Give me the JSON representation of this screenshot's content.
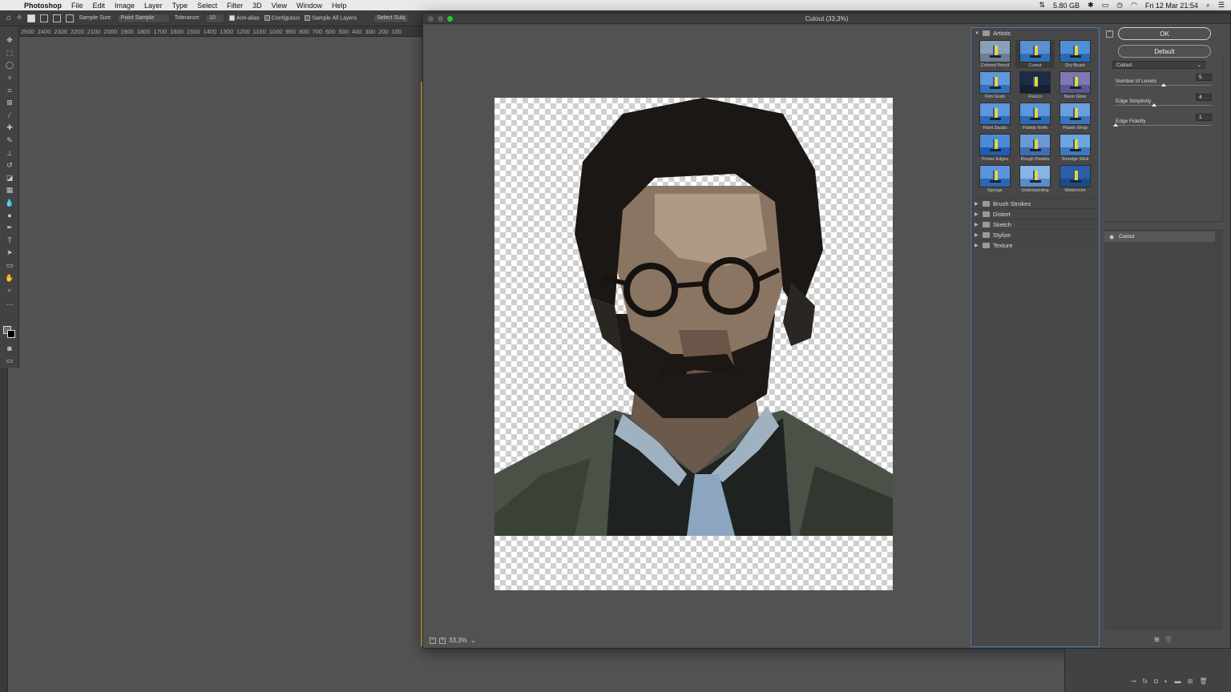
{
  "menubar": {
    "app": "Photoshop",
    "items": [
      "File",
      "Edit",
      "Image",
      "Layer",
      "Type",
      "Select",
      "Filter",
      "3D",
      "View",
      "Window",
      "Help"
    ],
    "memory": "5.80 GB",
    "clock": "Fri 12 Mar  21:54"
  },
  "options_bar": {
    "sample_size_label": "Sample Size:",
    "sample_size_value": "Point Sample",
    "tolerance_label": "Tolerance:",
    "tolerance_value": "10",
    "anti_alias": "Anti-alias",
    "contiguous": "Contiguous",
    "sample_all_layers": "Sample All Layers",
    "select_subject": "Select Subj"
  },
  "ruler": [
    "2500",
    "2400",
    "2300",
    "2200",
    "2100",
    "2000",
    "1900",
    "1800",
    "1700",
    "1600",
    "1500",
    "1400",
    "1300",
    "1200",
    "1100",
    "1000",
    "900",
    "800",
    "700",
    "600",
    "500",
    "400",
    "300",
    "200",
    "100"
  ],
  "dialog": {
    "title": "Cutout (33,3%)",
    "zoom": "33,3%",
    "ok": "OK",
    "default": "Default",
    "selected_filter": "Cutout"
  },
  "gallery": {
    "open_category": "Artistic",
    "filters": [
      {
        "label": "Colored Pencil",
        "sky": "#8aa0b8",
        "sea": "#6a7f96"
      },
      {
        "label": "Cutout",
        "sky": "#5a8fd0",
        "sea": "#2d6fb8",
        "selected": true
      },
      {
        "label": "Dry Brush",
        "sky": "#4f8fd8",
        "sea": "#2a6ab4"
      },
      {
        "label": "Film Grain",
        "sky": "#5e98dc",
        "sea": "#3270be"
      },
      {
        "label": "Fresco",
        "sky": "#1c2c44",
        "sea": "#152034"
      },
      {
        "label": "Neon Glow",
        "sky": "#7c7ab0",
        "sea": "#5a5890"
      },
      {
        "label": "Paint Daubs",
        "sky": "#5d96dc",
        "sea": "#2c6cb8"
      },
      {
        "label": "Palette Knife",
        "sky": "#5b95db",
        "sea": "#2b6ab6"
      },
      {
        "label": "Plastic Wrap",
        "sky": "#6b9fdc",
        "sea": "#3a74bc"
      },
      {
        "label": "Poster Edges",
        "sky": "#4d8ad6",
        "sea": "#1f5cb0"
      },
      {
        "label": "Rough Pastels",
        "sky": "#6a9ad4",
        "sea": "#3c6eb4"
      },
      {
        "label": "Smudge Stick",
        "sky": "#6ea4e0",
        "sea": "#3d78c0"
      },
      {
        "label": "Sponge",
        "sky": "#5b94da",
        "sea": "#2a68b4"
      },
      {
        "label": "Underpainting",
        "sky": "#86b4e4",
        "sea": "#5a8ccc"
      },
      {
        "label": "Watercolor",
        "sky": "#2c5ea8",
        "sea": "#1e4a8c"
      }
    ],
    "categories": [
      "Brush Strokes",
      "Distort",
      "Sketch",
      "Stylize",
      "Texture"
    ]
  },
  "settings": {
    "filter_select": "Cutout",
    "params": [
      {
        "label": "Number of Levels",
        "value": "5",
        "fraction": 0.5
      },
      {
        "label": "Edge Simplicity",
        "value": "4",
        "fraction": 0.4
      },
      {
        "label": "Edge Fidelity",
        "value": "1",
        "fraction": 0.0
      }
    ],
    "layer": "Cutout"
  }
}
